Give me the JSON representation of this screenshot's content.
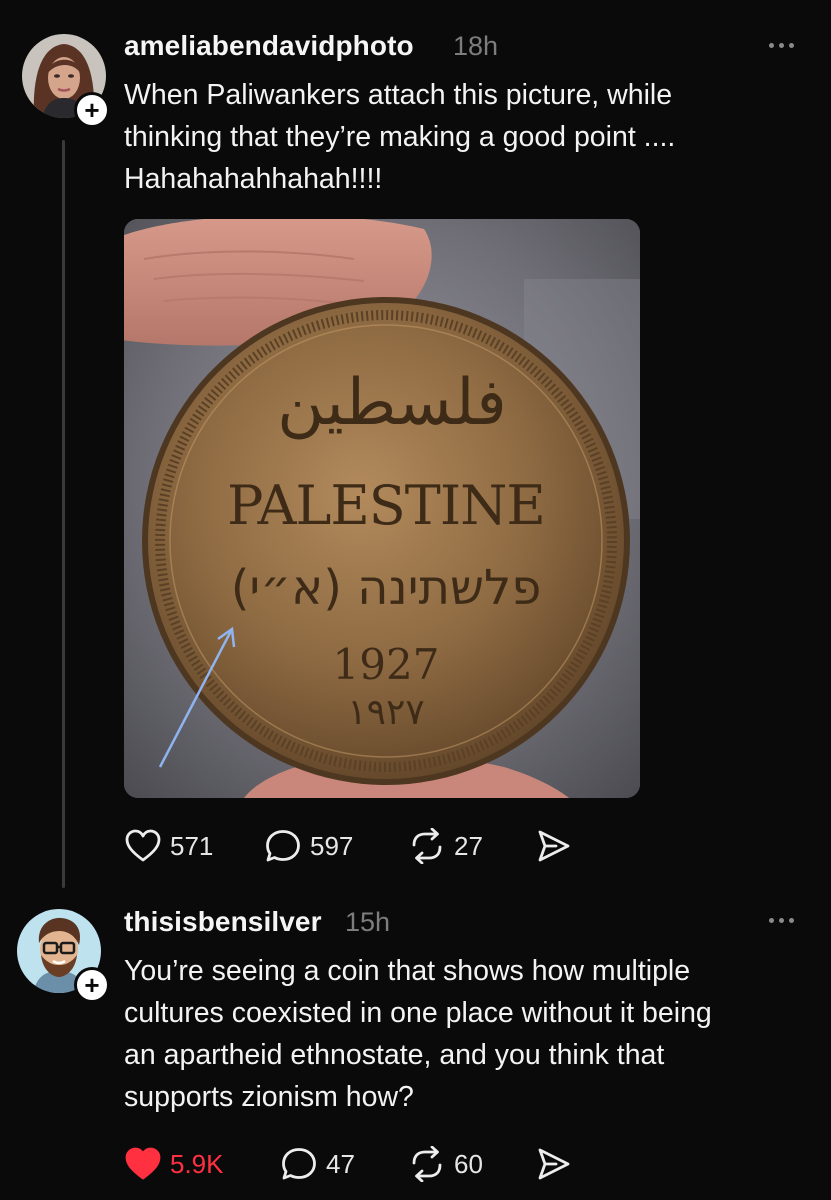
{
  "posts": [
    {
      "username": "ameliabendavidphoto",
      "time": "18h",
      "text": "When Paliwankers attach this picture, while\nthinking that they’re making a good point ....\nHahahahahhahah!!!!",
      "image": {
        "arabic": "فلسطين",
        "english": "PALESTINE",
        "hebrew": "פלשתינה (א״י)",
        "year": "1927",
        "year_arabic": "١٩٢٧"
      },
      "actions": {
        "likes": "571",
        "replies": "597",
        "reposts": "27"
      }
    },
    {
      "username": "thisisbensilver",
      "time": "15h",
      "text": "You’re seeing a coin that shows how multiple\ncultures coexisted in one place without it being\nan apartheid ethnostate, and you think that\nsupports zionism how?",
      "actions": {
        "likes": "5.9K",
        "replies": "47",
        "reposts": "60"
      }
    }
  ],
  "follow_badge": "+",
  "colors": {
    "background": "#0a0a0b",
    "text": "#f3f3f3",
    "muted": "#7d7d7d",
    "like_active": "#ff3040",
    "thread_line": "#3a3a3c"
  },
  "icons": [
    "heart-icon",
    "comment-icon",
    "repost-icon",
    "share-icon",
    "more-icon"
  ]
}
